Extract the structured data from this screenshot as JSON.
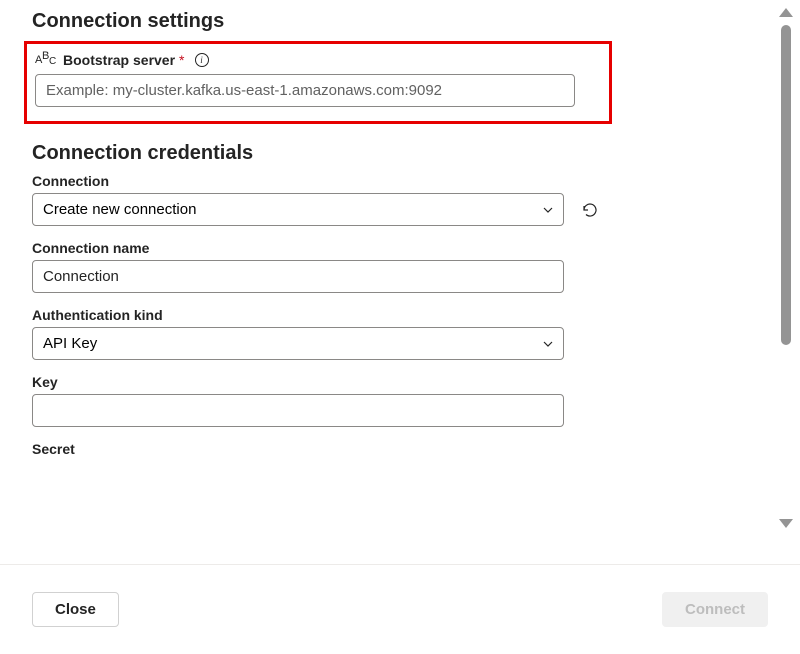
{
  "sections": {
    "settings_heading": "Connection settings",
    "credentials_heading": "Connection credentials"
  },
  "bootstrap": {
    "label": "Bootstrap server",
    "required": "*",
    "placeholder": "Example: my-cluster.kafka.us-east-1.amazonaws.com:9092",
    "value": ""
  },
  "connection": {
    "label": "Connection",
    "selected": "Create new connection"
  },
  "connection_name": {
    "label": "Connection name",
    "value": "Connection"
  },
  "auth_kind": {
    "label": "Authentication kind",
    "selected": "API Key"
  },
  "key": {
    "label": "Key",
    "value": ""
  },
  "secret": {
    "label": "Secret"
  },
  "footer": {
    "close": "Close",
    "connect": "Connect"
  }
}
